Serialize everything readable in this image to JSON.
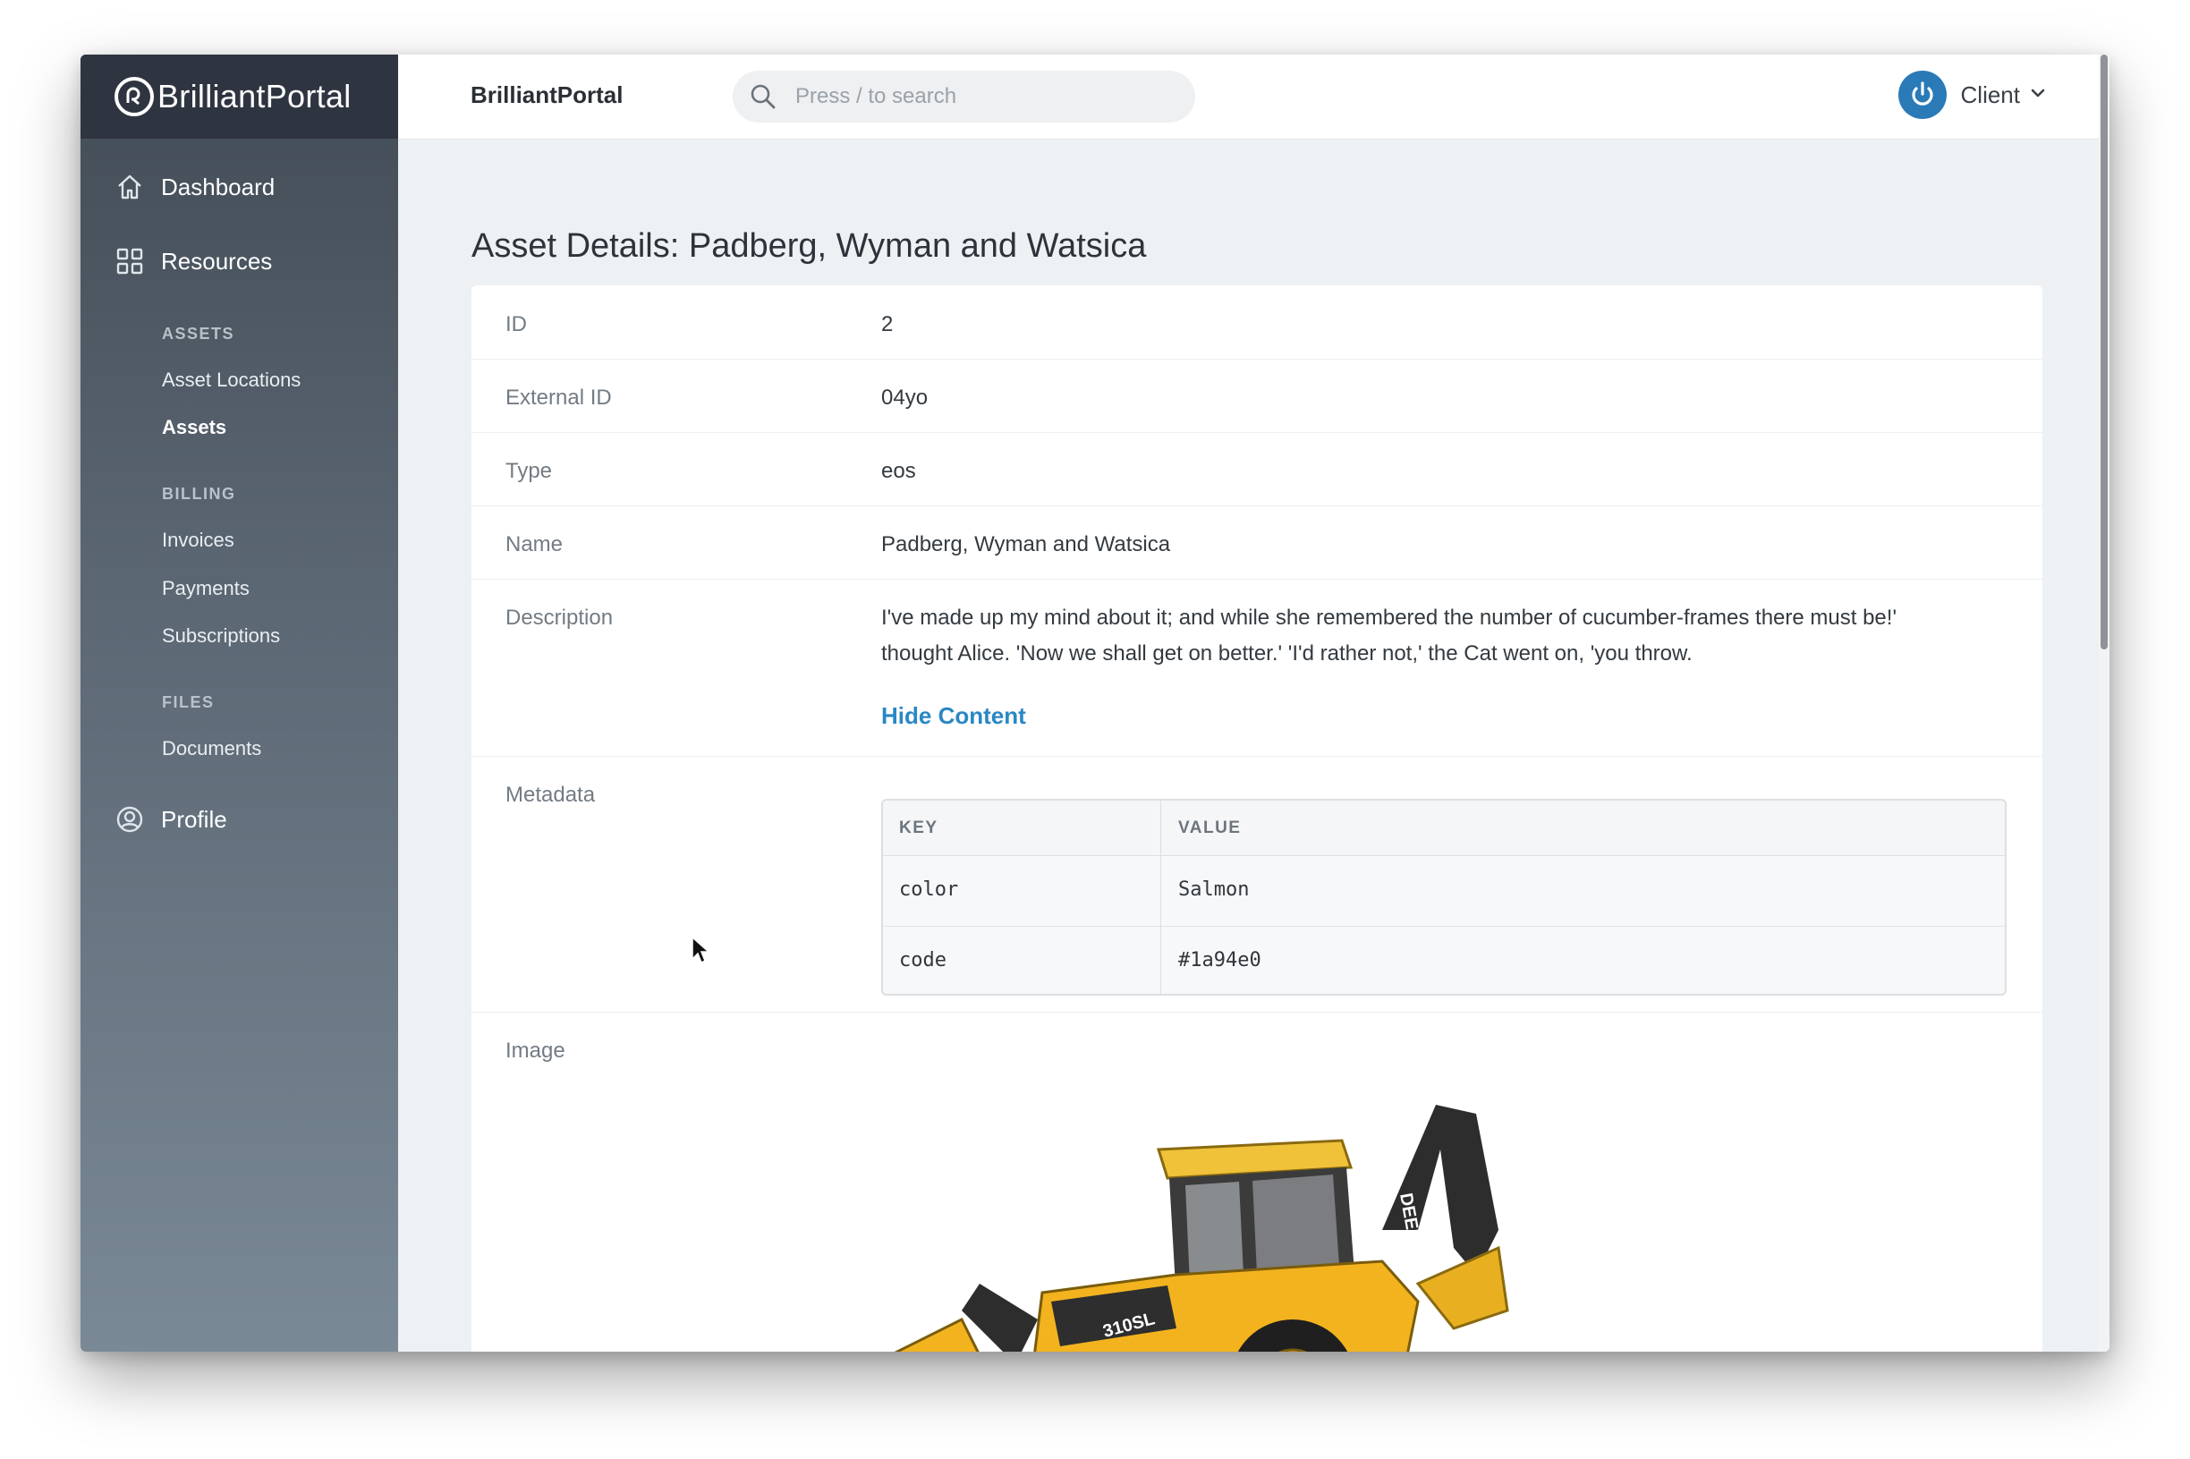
{
  "brand": {
    "name": "BrilliantPortal"
  },
  "sidebar": {
    "main": [
      {
        "label": "Dashboard",
        "icon": "home-icon"
      },
      {
        "label": "Resources",
        "icon": "grid-icon"
      },
      {
        "label": "Profile",
        "icon": "user-circle-icon"
      }
    ],
    "sections": [
      {
        "title": "ASSETS",
        "items": [
          "Asset Locations",
          "Assets"
        ]
      },
      {
        "title": "BILLING",
        "items": [
          "Invoices",
          "Payments",
          "Subscriptions"
        ]
      },
      {
        "title": "FILES",
        "items": [
          "Documents"
        ]
      }
    ],
    "active_item": "Assets"
  },
  "header": {
    "app_name": "BrilliantPortal",
    "search_placeholder": "Press / to search",
    "user_name": "Client"
  },
  "page": {
    "title": "Asset Details: Padberg, Wyman and Watsica",
    "fields": {
      "id": {
        "label": "ID",
        "value": "2"
      },
      "external_id": {
        "label": "External ID",
        "value": "04yo"
      },
      "type": {
        "label": "Type",
        "value": "eos"
      },
      "name": {
        "label": "Name",
        "value": "Padberg, Wyman and Watsica"
      },
      "description": {
        "label": "Description",
        "value": "I've made up my mind about it; and while she remembered the number of cucumber-frames there must be!' thought Alice. 'Now we shall get on better.' 'I'd rather not,' the Cat went on, 'you throw.",
        "toggle_label": "Hide Content"
      },
      "metadata": {
        "label": "Metadata",
        "columns": [
          "KEY",
          "VALUE"
        ],
        "rows": [
          {
            "key": "color",
            "value": "Salmon"
          },
          {
            "key": "code",
            "value": "#1a94e0"
          }
        ]
      },
      "image": {
        "label": "Image",
        "depicts": "yellow backhoe loader tractor",
        "model_text": "310SL",
        "brand_text": "DEERE"
      }
    }
  },
  "colors": {
    "accent": "#2a87c5",
    "sidebar_top": "#2f3540",
    "power_icon": "#2a7ab7"
  }
}
